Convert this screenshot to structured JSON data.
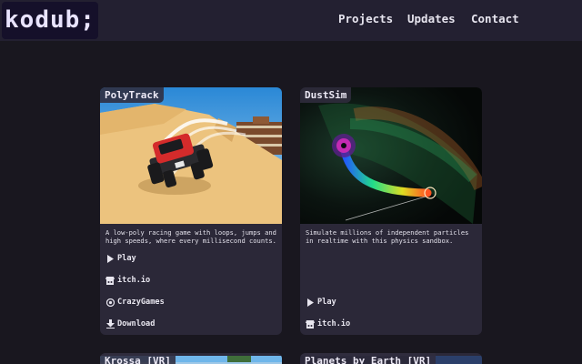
{
  "brand": {
    "logo_text": "kodub;"
  },
  "nav": {
    "items": [
      "Projects",
      "Updates",
      "Contact"
    ]
  },
  "cards": [
    {
      "title": "PolyTrack",
      "description": "A low-poly racing game with loops, jumps and high speeds, where every millisecond counts.",
      "links": [
        {
          "label": "Play",
          "icon": "play-icon"
        },
        {
          "label": "itch.io",
          "icon": "itchio-icon"
        },
        {
          "label": "CrazyGames",
          "icon": "crazygames-icon"
        },
        {
          "label": "Download",
          "icon": "download-icon"
        }
      ]
    },
    {
      "title": "DustSim",
      "description": "Simulate millions of independent particles in realtime with this physics sandbox.",
      "links": [
        {
          "label": "Play",
          "icon": "play-icon"
        },
        {
          "label": "itch.io",
          "icon": "itchio-icon"
        }
      ]
    },
    {
      "title": "Krossa [VR]"
    },
    {
      "title": "Planets by Earth [VR]"
    }
  ],
  "colors": {
    "background": "#19171f",
    "topbar": "#232031",
    "card": "#2b2838",
    "logo_bg": "#15102a"
  }
}
